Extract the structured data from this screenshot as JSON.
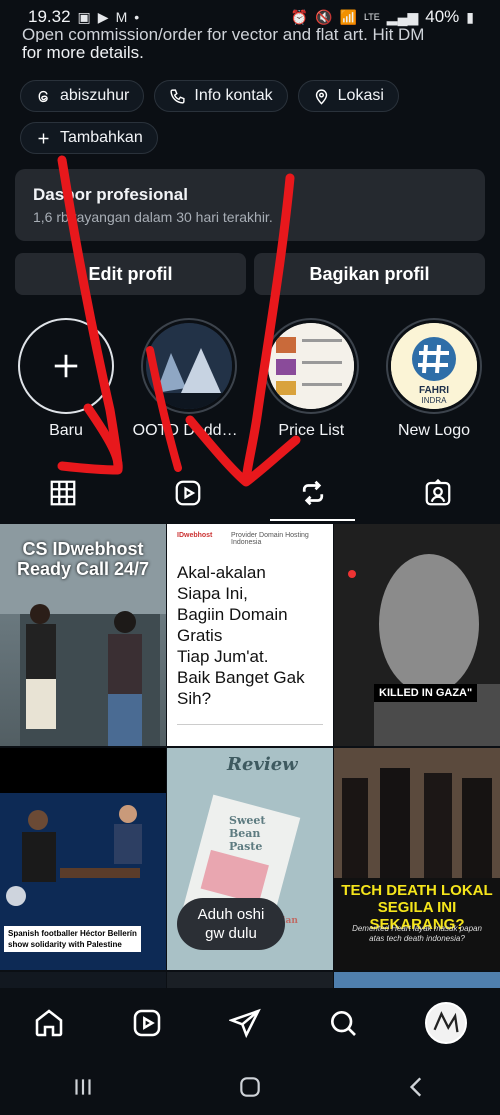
{
  "status_bar": {
    "time": "19.32",
    "battery": "40%",
    "network": "LTE"
  },
  "bio": {
    "line_cut": "Open commission/order for vector and flat art. Hit DM",
    "line2": "for more details."
  },
  "chips": [
    {
      "label": "abiszuhur",
      "icon": "threads-icon"
    },
    {
      "label": "Info kontak",
      "icon": "phone-icon"
    },
    {
      "label": "Lokasi",
      "icon": "location-pin-icon"
    },
    {
      "label": "Tambahkan",
      "icon": "plus-icon"
    }
  ],
  "dashboard": {
    "title": "Dasbor profesional",
    "subtitle": "1,6 rb tayangan dalam 30 hari terakhir."
  },
  "profile_buttons": {
    "edit": "Edit profil",
    "share": "Bagikan profil"
  },
  "highlights": [
    {
      "label": "Baru"
    },
    {
      "label": "OOTD Deddy JK..."
    },
    {
      "label": "Price List"
    },
    {
      "label": "New Logo"
    }
  ],
  "highlight_logo": {
    "title": "FAHRI",
    "subtitle": "INDRA"
  },
  "posts": {
    "p1": {
      "title": "CS IDwebhost",
      "subtitle": "Ready Call 24/7"
    },
    "p2": {
      "brand": "IDwebhost",
      "tagline": "Provider Domain Hosting Indonesia",
      "lines": [
        "Akal-akalan",
        "Siapa Ini,",
        "Bagiin Domain Gratis",
        "Tiap Jum'at.",
        "Baik Banget Gak Sih?"
      ]
    },
    "p3": {
      "caption": "KILLED IN GAZA\""
    },
    "p4": {
      "caption_line1": "Spanish footballer Héctor Bellerín",
      "caption_line2": "show solidarity with Palestine"
    },
    "p5": {
      "review": "Review",
      "book": "Sweet Bean Paste",
      "author": "Durian"
    },
    "p6": {
      "headline1": "TECH DEATH LOKAL",
      "headline2": "SEGILA INI SEKARANG?",
      "sub": "Demented Heart layak masuk papan atas tech death indonesia?"
    }
  },
  "toast": {
    "line1": "Aduh oshi",
    "line2": "gw dulu"
  },
  "colors": {
    "background": "#0b0f14",
    "panel": "#25292f",
    "annotation_red": "#e8181c",
    "headline_yellow": "#f5e51b"
  }
}
